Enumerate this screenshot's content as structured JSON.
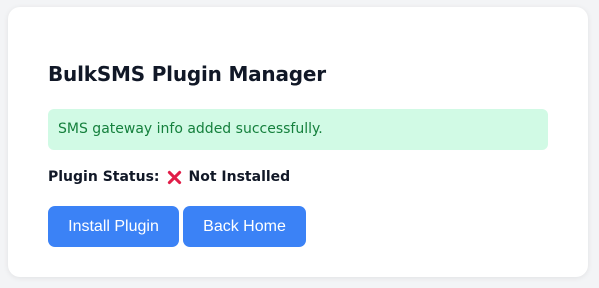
{
  "page": {
    "title": "BulkSMS Plugin Manager"
  },
  "alert": {
    "message": "SMS gateway info added successfully."
  },
  "status": {
    "label": "Plugin Status:",
    "icon": "cross-mark-icon",
    "value": "Not Installed"
  },
  "actions": {
    "install_label": "Install Plugin",
    "back_label": "Back Home"
  },
  "colors": {
    "accent": "#3b82f6",
    "success_bg": "#d1fae5",
    "success_text": "#15803d",
    "error": "#e11d48"
  }
}
